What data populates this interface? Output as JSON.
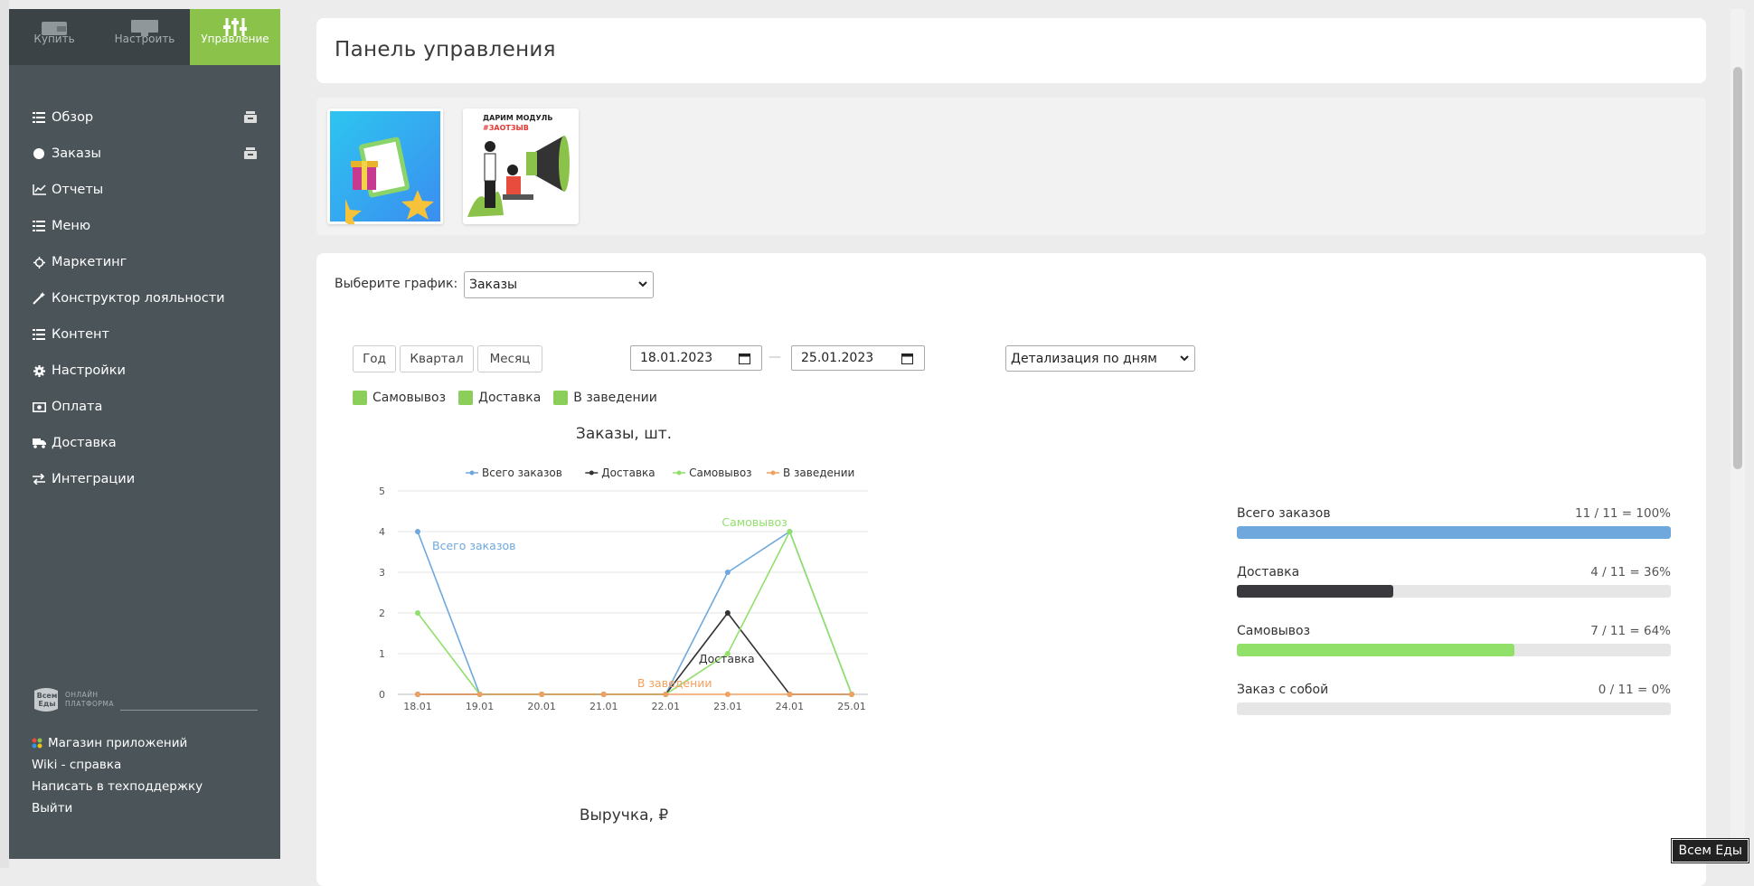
{
  "colors": {
    "sidebar": "#4b5459",
    "accent": "#8bc34a",
    "total": "#6fa8dc",
    "delivery": "#333333",
    "pickup": "#90e06a",
    "onsite": "#f0a060"
  },
  "sidebar": {
    "top_tabs": [
      {
        "label": "Купить",
        "icon": "wallet-icon",
        "active": false
      },
      {
        "label": "Настроить",
        "icon": "monitor-icon",
        "active": false
      },
      {
        "label": "Управление",
        "icon": "sliders-icon",
        "active": true
      }
    ],
    "items": [
      {
        "label": "Обзор",
        "icon": "list-icon"
      },
      {
        "label": "Заказы",
        "icon": "circle-icon"
      },
      {
        "label": "Отчеты",
        "icon": "line-chart-icon"
      },
      {
        "label": "Меню",
        "icon": "list-icon"
      },
      {
        "label": "Маркетинг",
        "icon": "crosshair-icon"
      },
      {
        "label": "Конструктор лояльности",
        "icon": "wand-icon"
      },
      {
        "label": "Контент",
        "icon": "list-icon"
      },
      {
        "label": "Настройки",
        "icon": "gear-icon"
      },
      {
        "label": "Оплата",
        "icon": "money-icon"
      },
      {
        "label": "Доставка",
        "icon": "truck-icon"
      },
      {
        "label": "Интеграции",
        "icon": "exchange-icon"
      }
    ],
    "logo": {
      "brand": "Всем Еды",
      "line1": "ОНЛАЙН",
      "line2": "ПЛАТФОРМА"
    },
    "footer_links": [
      "Магазин приложений",
      "Wiki - справка",
      "Написать в техподдержку",
      "Выйти"
    ]
  },
  "header": {
    "title": "Панель управления"
  },
  "banners": [
    {
      "icon": "survey-banner-icon"
    },
    {
      "icon": "promo-banner-icon",
      "line1": "ДАРИМ МОДУЛЬ",
      "line2": "#ЗАОТЗЫВ"
    }
  ],
  "controls": {
    "chart_label": "Выберите график:",
    "chart_select": "Заказы",
    "period_buttons": [
      "Год",
      "Квартал",
      "Месяц"
    ],
    "date_from": "18.01.2023",
    "date_to": "25.01.2023",
    "date_dash": "—",
    "detail_select": "Детализация по дням",
    "filters": [
      "Самовывоз",
      "Доставка",
      "В заведении"
    ]
  },
  "chart_data": {
    "type": "line",
    "title": "Заказы, шт.",
    "categories": [
      "18.01",
      "19.01",
      "20.01",
      "21.01",
      "22.01",
      "23.01",
      "24.01",
      "25.01"
    ],
    "ylim": [
      0,
      5
    ],
    "yticks": [
      "0",
      "1",
      "2",
      "3",
      "4",
      "5"
    ],
    "grid": true,
    "legend_placement": "top",
    "series": [
      {
        "name": "Всего заказов",
        "color": "#6fa8dc",
        "values": [
          4,
          0,
          0,
          0,
          0,
          3,
          4,
          0
        ],
        "annotation": "Всего заказов",
        "annotation_index": 0
      },
      {
        "name": "Доставка",
        "color": "#333333",
        "values": [
          0,
          0,
          0,
          0,
          0,
          2,
          0,
          0
        ],
        "annotation": "Доставка",
        "annotation_index": 5
      },
      {
        "name": "Самовывоз",
        "color": "#90e06a",
        "values": [
          2,
          0,
          0,
          0,
          0,
          1,
          4,
          0
        ],
        "annotation": "Самовывоз",
        "annotation_index": 6
      },
      {
        "name": "В заведении",
        "color": "#f0a060",
        "values": [
          0,
          0,
          0,
          0,
          0,
          0,
          0,
          0
        ],
        "annotation": "В заведении",
        "annotation_index": 5
      }
    ]
  },
  "revenue_chart": {
    "title": "Выручка, ₽"
  },
  "stats": [
    {
      "name": "Всего заказов",
      "value": "11 / 11 = 100%",
      "fraction": 1.0,
      "color": "#6fa8dc"
    },
    {
      "name": "Доставка",
      "value": "4 / 11 = 36%",
      "fraction": 0.36,
      "color": "#3a3a3e"
    },
    {
      "name": "Самовывоз",
      "value": "7 / 11 = 64%",
      "fraction": 0.64,
      "color": "#90e06a"
    },
    {
      "name": "Заказ с собой",
      "value": "0 / 11 = 0%",
      "fraction": 0.0,
      "color": "#8bc34a"
    }
  ],
  "tooltip": "Всем Еды"
}
